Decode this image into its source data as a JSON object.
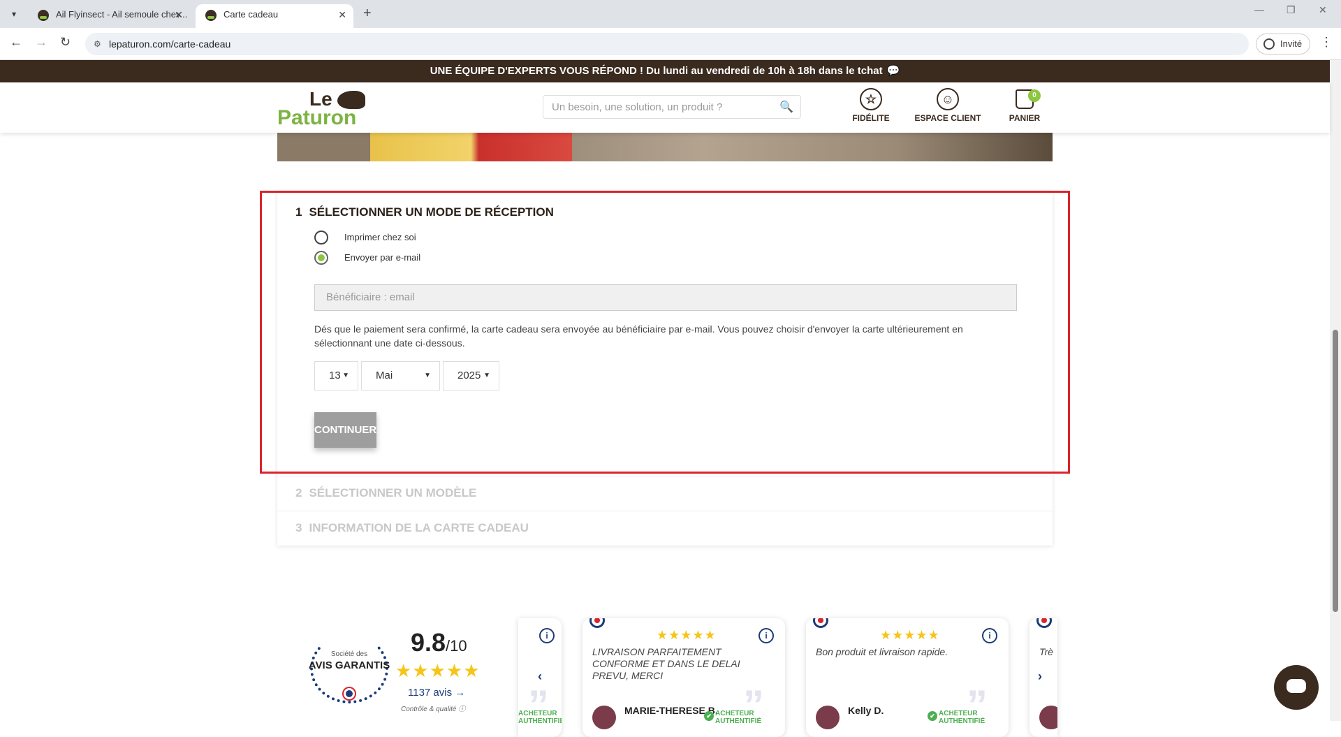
{
  "browser": {
    "tabs": [
      {
        "title": "Ail Flyinsect - Ail semoule chev...",
        "active": false
      },
      {
        "title": "Carte cadeau",
        "active": true
      }
    ],
    "url": "lepaturon.com/carte-cadeau",
    "profile": "Invité"
  },
  "promo": {
    "text": "UNE ÉQUIPE D'EXPERTS VOUS RÉPOND ! Du lundi au vendredi de 10h à 18h dans le tchat"
  },
  "header": {
    "logo_top": "Le",
    "logo_bottom": "Paturon",
    "search_placeholder": "Un besoin, une solution, un produit ?",
    "fidelite": "FIDÉLITE",
    "espace_client": "ESPACE CLIENT",
    "panier": "PANIER",
    "cart_count": "0"
  },
  "form": {
    "step1_num": "1",
    "step1_title": "SÉLECTIONNER UN MODE DE RÉCEPTION",
    "option_print": "Imprimer chez soi",
    "option_email": "Envoyer par e-mail",
    "email_placeholder": "Bénéficiaire : email",
    "description": "Dés que le paiement sera confirmé, la carte cadeau sera envoyée au bénéficiaire par e-mail. Vous pouvez choisir d'envoyer la carte ultérieurement en sélectionnant une date ci-dessous.",
    "day": "13",
    "month": "Mai",
    "year": "2025",
    "continue": "CONTINUER",
    "step2_num": "2",
    "step2_title": "SÉLECTIONNER UN MODÈLE",
    "step3_num": "3",
    "step3_title": "INFORMATION DE LA CARTE CADEAU"
  },
  "reviews": {
    "seal_top": "Société des",
    "seal_main": "AVIS GARANTIS",
    "score": "9.8",
    "score_den": "/10",
    "count": "1137 avis",
    "quality": "Contrôle & qualité",
    "items": [
      {
        "text": "LIVRAISON PARFAITEMENT CONFORME ET DANS LE DELAI PREVU, MERCI",
        "name": "MARIE-THERESE B.",
        "badge": "ACHETEUR AUTHENTIFIÉ"
      },
      {
        "text": "Bon produit et livraison rapide.",
        "name": "Kelly D.",
        "badge": "ACHETEUR AUTHENTIFIÉ"
      },
      {
        "text": "Trè",
        "name": "",
        "badge": ""
      }
    ],
    "partial_badge": "ACHETEUR AUTHENTIFIÉ"
  }
}
